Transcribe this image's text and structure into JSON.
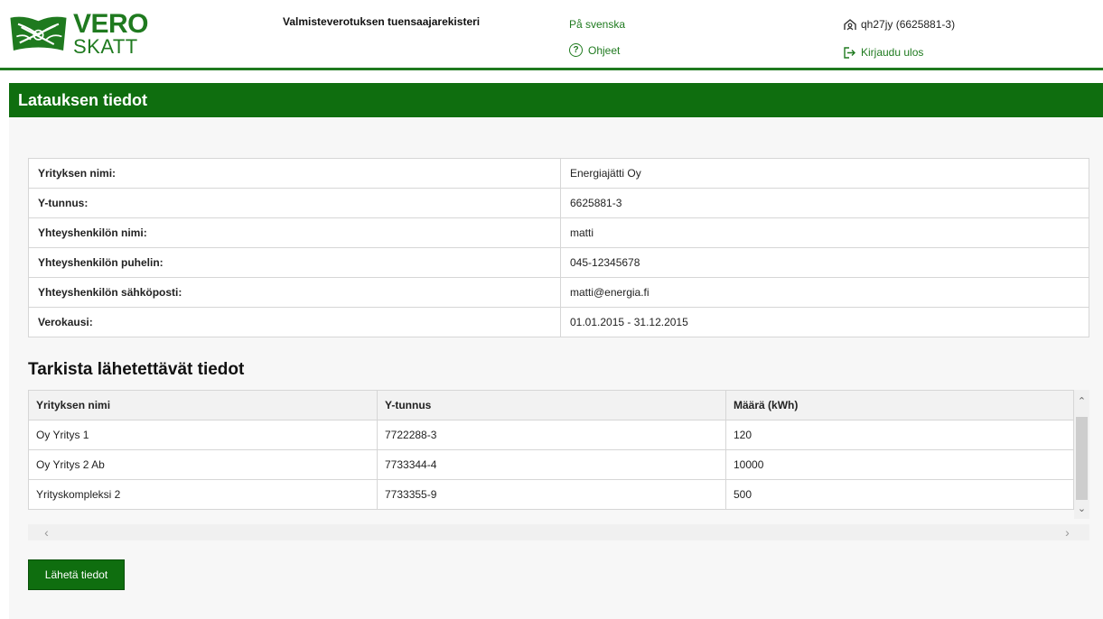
{
  "header": {
    "logo_vero": "VERO",
    "logo_skatt": "SKATT",
    "app_title": "Valmisteverotuksen tuensaajarekisteri",
    "language_link": "På svenska",
    "help_link": "Ohjeet",
    "user_label": "qh27jy (6625881-3)",
    "logout_label": "Kirjaudu ulos"
  },
  "page_title": "Latauksen tiedot",
  "info": [
    {
      "label": "Yrityksen nimi:",
      "value": "Energiajätti Oy"
    },
    {
      "label": "Y-tunnus:",
      "value": "6625881-3"
    },
    {
      "label": "Yhteyshenkilön nimi:",
      "value": "matti"
    },
    {
      "label": "Yhteyshenkilön puhelin:",
      "value": "045-12345678"
    },
    {
      "label": "Yhteyshenkilön sähköposti:",
      "value": "matti@energia.fi"
    },
    {
      "label": "Verokausi:",
      "value": "01.01.2015 - 31.12.2015"
    }
  ],
  "section_title": "Tarkista lähetettävät tiedot",
  "table": {
    "columns": [
      "Yrityksen nimi",
      "Y-tunnus",
      "Määrä (kWh)"
    ],
    "rows": [
      [
        "Oy Yritys 1",
        "7722288-3",
        "120"
      ],
      [
        "Oy Yritys 2 Ab",
        "7733344-4",
        "10000"
      ],
      [
        "Yrityskompleksi 2",
        "7733355-9",
        "500"
      ]
    ]
  },
  "send_button": "Lähetä tiedot",
  "colors": {
    "brand_green": "#0f6e0f",
    "link_green": "#1f7a1f"
  },
  "icons": [
    "logo-emblem-icon",
    "help-circle-icon",
    "user-icon",
    "logout-icon"
  ]
}
